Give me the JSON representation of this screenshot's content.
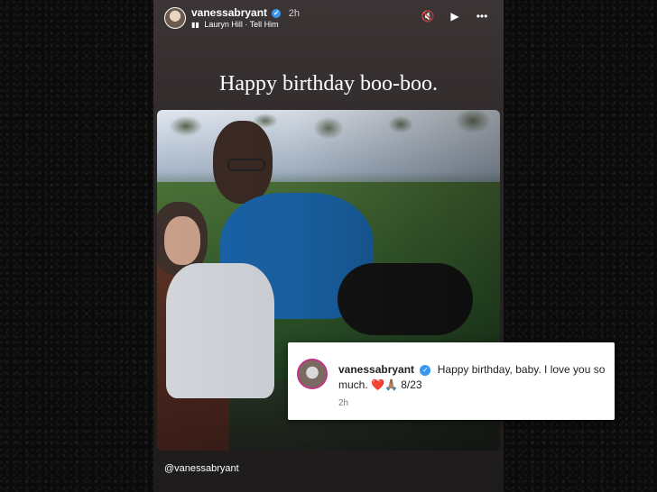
{
  "story": {
    "username": "vanessabryant",
    "time": "2h",
    "music": "Lauryn Hill · Tell Him",
    "headline": "Happy birthday boo-boo.",
    "caption": "@vanessabryant"
  },
  "controls": {
    "mute_icon": "mute-icon",
    "play_icon": "play-icon",
    "more_icon": "more-icon"
  },
  "comment": {
    "username": "vanessabryant",
    "text": "Happy birthday, baby. I love you so much. ❤️🙏🏽 8/23",
    "time": "2h"
  },
  "colors": {
    "verified": "#3897f0",
    "story_gradient_top": "#3c3536",
    "story_gradient_bottom": "#1e1b1c"
  }
}
